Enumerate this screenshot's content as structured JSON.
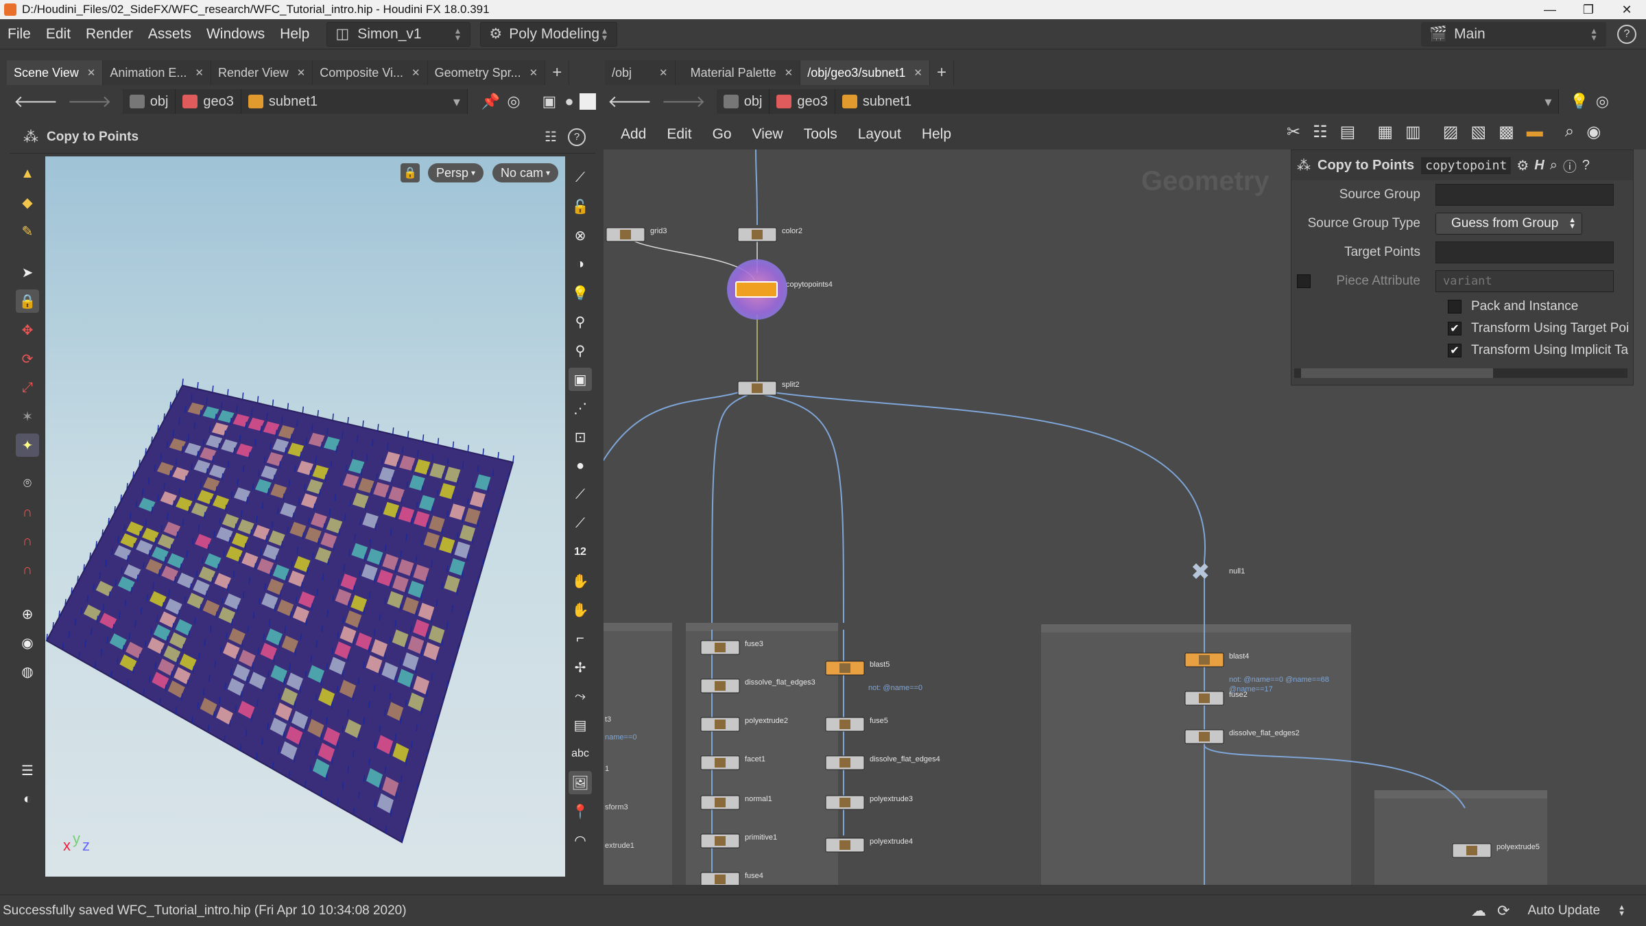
{
  "window": {
    "title": "D:/Houdini_Files/02_SideFX/WFC_research/WFC_Tutorial_intro.hip - Houdini FX 18.0.391",
    "controls": [
      "—",
      "❐",
      "✕"
    ]
  },
  "menubar": {
    "items": [
      "File",
      "Edit",
      "Render",
      "Assets",
      "Windows",
      "Help"
    ],
    "desktop": "Simon_v1",
    "shelf_set": "Poly Modeling",
    "main_desktop": "Main",
    "help": "?"
  },
  "left_tabs": [
    "Scene View",
    "Animation E...",
    "Render View",
    "Composite Vi...",
    "Geometry Spr..."
  ],
  "right_tabs": [
    "/obj",
    "Material Palette",
    "/obj/geo3/subnet1"
  ],
  "left_path": [
    "obj",
    "geo3",
    "subnet1"
  ],
  "right_path": [
    "obj",
    "geo3",
    "subnet1"
  ],
  "viewer": {
    "tool_name": "Copy to Points",
    "persp": "Persp",
    "cam": "No cam",
    "axes": "xyz"
  },
  "network_menu": [
    "Add",
    "Edit",
    "Go",
    "View",
    "Tools",
    "Layout",
    "Help"
  ],
  "network": {
    "context_label": "Geometry",
    "nodes": {
      "grid3": "grid3",
      "color2": "color2",
      "copytopoints4": "copytopoints4",
      "split2": "split2",
      "null1": "null1",
      "fuse3": "fuse3",
      "blast5": "blast5",
      "dissolve_flat_edges3": "dissolve_flat_edges3",
      "blast5_note": "not: @name==0",
      "polyextrude2": "polyextrude2",
      "fuse5": "fuse5",
      "facet1": "facet1",
      "dissolve_flat_edges4": "dissolve_flat_edges4",
      "normal1": "normal1",
      "polyextrude3": "polyextrude3",
      "primitive1": "primitive1",
      "polyextrude4": "polyextrude4",
      "fuse4": "fuse4",
      "blast4": "blast4",
      "blast4_note1": "not: @name==0 @name==68",
      "blast4_note2": "@name==17",
      "fuse2": "fuse2",
      "dissolve_flat_edges2": "dissolve_flat_edges2",
      "polyextrude5": "polyextrude5",
      "left_frag1": "t3",
      "left_frag2": "name==0",
      "left_frag3": "1",
      "left_frag4": "sform3",
      "left_frag5": "extrude1"
    }
  },
  "params": {
    "node_type": "Copy to Points",
    "node_name": "copytopoint",
    "fields": [
      {
        "label": "Source Group",
        "value": ""
      },
      {
        "label": "Source Group Type",
        "value": "Guess from Group"
      },
      {
        "label": "Target Points",
        "value": ""
      },
      {
        "label": "Piece Attribute",
        "value": "variant"
      }
    ],
    "checks": [
      {
        "label": "Pack and Instance",
        "checked": false
      },
      {
        "label": "Transform Using Target Poi",
        "checked": true
      },
      {
        "label": "Transform Using Implicit Ta",
        "checked": true
      }
    ]
  },
  "status": {
    "message": "Successfully saved WFC_Tutorial_intro.hip (Fri Apr 10 10:34:08 2020)",
    "auto_update": "Auto Update"
  },
  "colors": {
    "accent_orange": "#f0a020",
    "grid_purple": "#3a2d7a",
    "wire_blue": "#7fa6d8",
    "tile_pink": "#d9508a",
    "tile_yellow": "#c8c02a",
    "tile_teal": "#4fb0b0"
  }
}
